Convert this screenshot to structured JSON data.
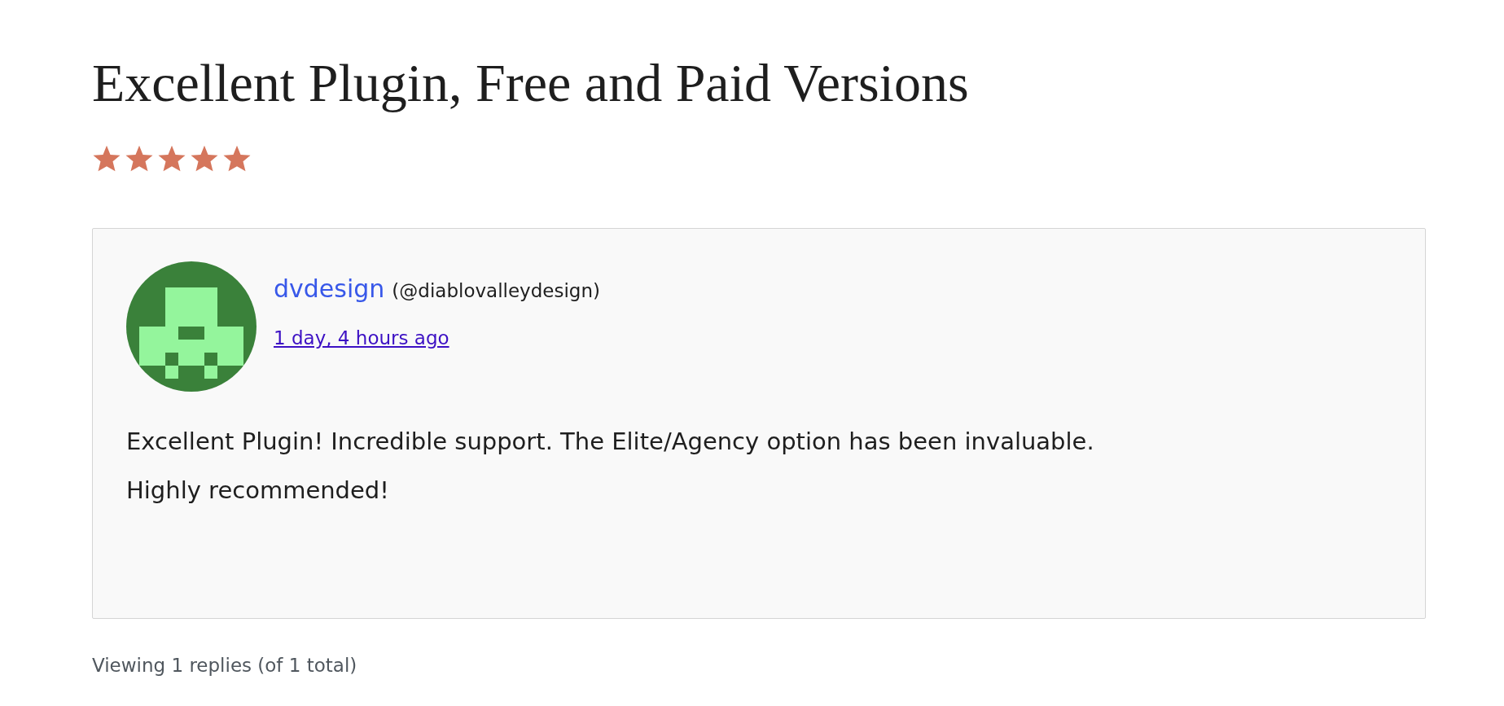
{
  "title": "Excellent Plugin, Free and Paid Versions",
  "stars": 5,
  "reply": {
    "author": "dvdesign",
    "handle": "(@diablovalleydesign)",
    "time": "1 day, 4 hours ago",
    "paragraphs": [
      "Excellent Plugin! Incredible support. The Elite/Agency option has been invaluable.",
      "Highly recommended!"
    ]
  },
  "footer": "Viewing 1 replies (of 1 total)"
}
